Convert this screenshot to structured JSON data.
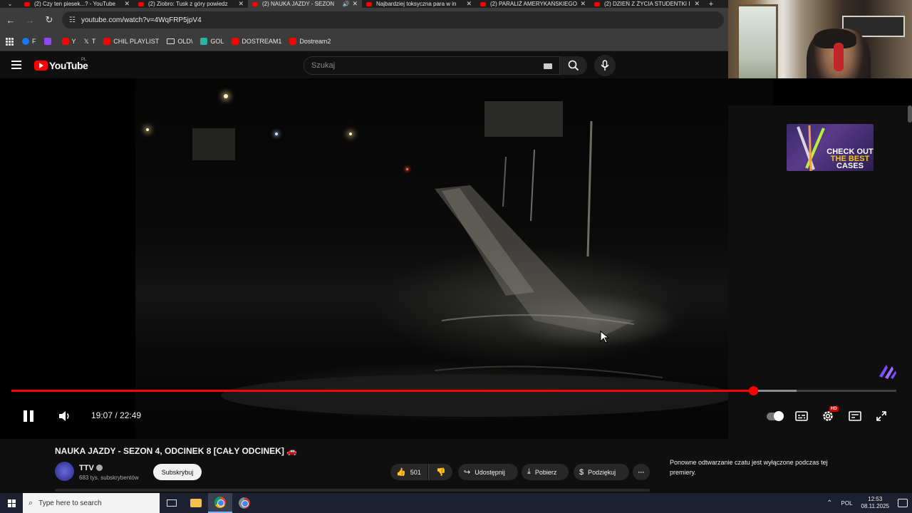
{
  "browser": {
    "tabs": [
      {
        "label": "(2) Czy ten piesek...? - YouTube",
        "active": false,
        "audio": false
      },
      {
        "label": "(2) Ziobro: Tusk z góry powiedz",
        "active": false,
        "audio": false
      },
      {
        "label": "(2) NAUKA JAZDY - SEZON",
        "active": true,
        "audio": true
      },
      {
        "label": "Najbardziej toksyczna para w in",
        "active": false,
        "audio": false
      },
      {
        "label": "(2) PARALIŻ AMERYKAŃSKIEGO",
        "active": false,
        "audio": false
      },
      {
        "label": "(2) DZIEŃ Z ŻYCIA STUDENTKI I",
        "active": false,
        "audio": false
      }
    ],
    "close_glyph": "✕",
    "new_tab_glyph": "+",
    "url": "youtube.com/watch?v=4WqFRP5jpV4",
    "bookmarks": [
      {
        "label": "F",
        "icon": "facebook-icon",
        "color": "#1877f2"
      },
      {
        "label": "",
        "icon": "twitch-icon",
        "color": "#9146ff"
      },
      {
        "label": "Y",
        "icon": "youtube-icon",
        "color": "#ff0000"
      },
      {
        "label": "T",
        "icon": "x-icon",
        "color": "#ffffff"
      },
      {
        "label": "CHIL PLAYLIST",
        "icon": "youtube-icon",
        "color": "#ff0000"
      },
      {
        "label": "OLD\\",
        "icon": "folder-icon",
        "color": "#dddddd"
      },
      {
        "label": "GOL",
        "icon": "gol-icon",
        "color": "#2bb3a0"
      },
      {
        "label": "DOSTREAM1",
        "icon": "youtube-icon",
        "color": "#ff0000"
      },
      {
        "label": "Dostream2",
        "icon": "youtube-icon",
        "color": "#ff0000"
      }
    ]
  },
  "youtube": {
    "logo_text": "YouTube",
    "logo_country": "PL",
    "search_placeholder": "Szukaj"
  },
  "ad": {
    "line1": "CHECK OUT",
    "line2": "THE BEST",
    "line3": "CASES"
  },
  "player": {
    "current_time": "19:07",
    "duration": "22:49",
    "timecode": "19:07 / 22:49",
    "progress_fraction": 0.838,
    "buffered_fraction": 0.887,
    "hd_badge": "HD"
  },
  "video_info": {
    "title": "NAUKA JAZDY - SEZON 4, ODCINEK 8 [CAŁY ODCINEK] 🚗",
    "channel": "TTV",
    "subscribers": "683 tys. subskrybentów",
    "subscribe_label": "Subskrybuj",
    "likes": "501",
    "share_label": "Udostępnij",
    "download_label": "Pobierz",
    "thanks_label": "Podziękuj",
    "more_glyph": "···"
  },
  "chat": {
    "notice": "Ponowne odtwarzanie czatu jest wyłączone podczas tej premiery."
  },
  "taskbar": {
    "search_placeholder": "Type here to search",
    "language": "POL",
    "time": "12:53",
    "date": "08.11.2025"
  },
  "colors": {
    "accent": "#ff0000",
    "background": "#0f0f0f",
    "taskbar": "#1c2030"
  }
}
